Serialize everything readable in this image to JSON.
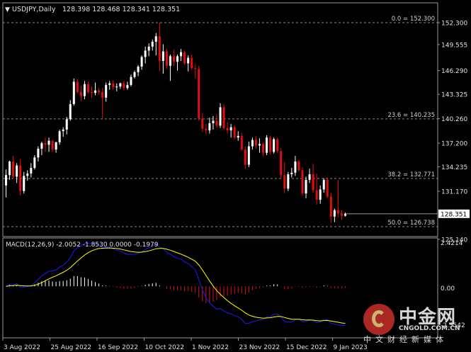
{
  "header": {
    "symbol_label": "USDJPY,Daily",
    "ohlc": "128.398 128.468 128.341 128.351",
    "marker": "▼"
  },
  "macd": {
    "label": "MACD(12,26,9) -2.0052 -1.8530 0.0000 -0.1979",
    "axis_top": "2.4214",
    "axis_zero": "0.00",
    "axis_bottom": "-2.5542"
  },
  "current_price_label": "128.351",
  "colors": {
    "bg": "#000000",
    "up": "#ffffff",
    "down": "#e01010",
    "fib": "#8a8a8a",
    "signal": "#ffff00",
    "macd_main": "#1a1aff",
    "text": "#d0d0d0"
  },
  "fib_levels": [
    {
      "label": "0.0 = 152.300",
      "price": 152.3
    },
    {
      "label": "23.6 = 140.235",
      "price": 140.235
    },
    {
      "label": "38.2 = 132.771",
      "price": 132.771
    },
    {
      "label": "50.0 = 126.738",
      "price": 126.738
    }
  ],
  "y_ticks": [
    "152.300",
    "149.555",
    "146.290",
    "143.325",
    "140.260",
    "137.200",
    "134.235",
    "131.170",
    "128.351",
    "125.140"
  ],
  "y_tick_values": [
    152.3,
    149.555,
    146.29,
    143.325,
    140.26,
    137.2,
    134.235,
    131.17,
    128.351,
    125.14
  ],
  "x_ticks": [
    "3 Aug 2022",
    "25 Aug 2022",
    "16 Sep 2022",
    "10 Oct 2022",
    "1 Nov 2022",
    "23 Nov 2022",
    "15 Dec 2022",
    "9 Jan 2023"
  ],
  "watermark": {
    "title": "中金网",
    "url": "CNGOLD.COM.CN",
    "tagline": "中文财经新媒体"
  },
  "chart_data": {
    "type": "candlestick",
    "title": "USDJPY,Daily",
    "candles": [
      {
        "o": 131.9,
        "h": 133.9,
        "l": 130.4,
        "c": 133.2
      },
      {
        "o": 133.2,
        "h": 135.0,
        "l": 132.6,
        "c": 134.9
      },
      {
        "o": 134.9,
        "h": 135.6,
        "l": 132.7,
        "c": 133.0
      },
      {
        "o": 133.0,
        "h": 134.7,
        "l": 132.2,
        "c": 134.4
      },
      {
        "o": 134.4,
        "h": 135.2,
        "l": 130.6,
        "c": 131.2
      },
      {
        "o": 131.2,
        "h": 133.6,
        "l": 130.9,
        "c": 133.1
      },
      {
        "o": 133.1,
        "h": 133.8,
        "l": 132.5,
        "c": 133.4
      },
      {
        "o": 133.4,
        "h": 134.7,
        "l": 132.9,
        "c": 134.1
      },
      {
        "o": 134.1,
        "h": 135.7,
        "l": 133.9,
        "c": 135.4
      },
      {
        "o": 135.4,
        "h": 136.8,
        "l": 134.9,
        "c": 136.5
      },
      {
        "o": 136.5,
        "h": 137.4,
        "l": 135.7,
        "c": 137.2
      },
      {
        "o": 137.2,
        "h": 137.9,
        "l": 136.1,
        "c": 137.0
      },
      {
        "o": 137.0,
        "h": 137.9,
        "l": 136.1,
        "c": 137.5
      },
      {
        "o": 137.5,
        "h": 137.6,
        "l": 136.1,
        "c": 136.4
      },
      {
        "o": 136.4,
        "h": 137.4,
        "l": 136.0,
        "c": 137.3
      },
      {
        "o": 137.3,
        "h": 138.9,
        "l": 137.0,
        "c": 138.7
      },
      {
        "o": 138.7,
        "h": 139.2,
        "l": 138.0,
        "c": 138.9
      },
      {
        "o": 138.9,
        "h": 140.5,
        "l": 138.3,
        "c": 140.2
      },
      {
        "o": 140.2,
        "h": 142.6,
        "l": 140.0,
        "c": 142.1
      },
      {
        "o": 142.1,
        "h": 145.3,
        "l": 141.9,
        "c": 144.9
      },
      {
        "o": 144.9,
        "h": 145.2,
        "l": 143.4,
        "c": 143.6
      },
      {
        "o": 143.6,
        "h": 144.4,
        "l": 142.5,
        "c": 143.1
      },
      {
        "o": 143.1,
        "h": 145.0,
        "l": 142.7,
        "c": 144.6
      },
      {
        "o": 144.6,
        "h": 144.9,
        "l": 143.4,
        "c": 143.6
      },
      {
        "o": 143.6,
        "h": 144.3,
        "l": 142.9,
        "c": 143.5
      },
      {
        "o": 143.5,
        "h": 144.8,
        "l": 143.2,
        "c": 143.8
      },
      {
        "o": 143.8,
        "h": 144.1,
        "l": 143.3,
        "c": 143.6
      },
      {
        "o": 143.6,
        "h": 144.1,
        "l": 140.3,
        "c": 142.9
      },
      {
        "o": 142.9,
        "h": 144.8,
        "l": 142.4,
        "c": 144.5
      },
      {
        "o": 144.5,
        "h": 145.0,
        "l": 143.9,
        "c": 144.7
      },
      {
        "o": 144.7,
        "h": 145.1,
        "l": 143.9,
        "c": 144.2
      },
      {
        "o": 144.2,
        "h": 144.7,
        "l": 143.7,
        "c": 144.3
      },
      {
        "o": 144.3,
        "h": 144.8,
        "l": 144.0,
        "c": 144.7
      },
      {
        "o": 144.7,
        "h": 145.0,
        "l": 143.8,
        "c": 144.1
      },
      {
        "o": 144.1,
        "h": 144.9,
        "l": 143.9,
        "c": 144.5
      },
      {
        "o": 144.5,
        "h": 145.8,
        "l": 144.3,
        "c": 145.5
      },
      {
        "o": 145.5,
        "h": 146.3,
        "l": 145.3,
        "c": 146.1
      },
      {
        "o": 146.1,
        "h": 147.0,
        "l": 145.6,
        "c": 146.8
      },
      {
        "o": 146.8,
        "h": 148.2,
        "l": 146.4,
        "c": 148.0
      },
      {
        "o": 148.0,
        "h": 149.3,
        "l": 147.2,
        "c": 148.8
      },
      {
        "o": 148.8,
        "h": 149.7,
        "l": 148.1,
        "c": 149.3
      },
      {
        "o": 149.3,
        "h": 150.2,
        "l": 148.8,
        "c": 149.9
      },
      {
        "o": 149.9,
        "h": 151.0,
        "l": 148.2,
        "c": 150.6
      },
      {
        "o": 150.6,
        "h": 152.3,
        "l": 146.2,
        "c": 147.5
      },
      {
        "o": 147.5,
        "h": 149.6,
        "l": 145.9,
        "c": 148.7
      },
      {
        "o": 148.7,
        "h": 149.0,
        "l": 146.5,
        "c": 146.9
      },
      {
        "o": 146.9,
        "h": 148.3,
        "l": 145.0,
        "c": 148.1
      },
      {
        "o": 148.1,
        "h": 148.9,
        "l": 146.9,
        "c": 147.4
      },
      {
        "o": 147.4,
        "h": 148.3,
        "l": 146.3,
        "c": 148.1
      },
      {
        "o": 148.1,
        "h": 149.0,
        "l": 147.5,
        "c": 148.6
      },
      {
        "o": 148.6,
        "h": 148.8,
        "l": 147.0,
        "c": 147.2
      },
      {
        "o": 147.2,
        "h": 148.2,
        "l": 146.2,
        "c": 147.9
      },
      {
        "o": 147.9,
        "h": 148.3,
        "l": 146.4,
        "c": 146.6
      },
      {
        "o": 146.6,
        "h": 147.1,
        "l": 145.3,
        "c": 146.5
      },
      {
        "o": 146.5,
        "h": 146.9,
        "l": 140.0,
        "c": 140.3
      },
      {
        "o": 140.3,
        "h": 141.0,
        "l": 138.6,
        "c": 139.0
      },
      {
        "o": 139.0,
        "h": 139.6,
        "l": 138.3,
        "c": 138.8
      },
      {
        "o": 138.8,
        "h": 140.4,
        "l": 138.4,
        "c": 139.7
      },
      {
        "o": 139.7,
        "h": 140.6,
        "l": 138.9,
        "c": 140.0
      },
      {
        "o": 140.0,
        "h": 140.8,
        "l": 139.1,
        "c": 139.4
      },
      {
        "o": 139.4,
        "h": 142.2,
        "l": 139.1,
        "c": 141.7
      },
      {
        "o": 141.7,
        "h": 142.1,
        "l": 138.9,
        "c": 139.1
      },
      {
        "o": 139.1,
        "h": 139.8,
        "l": 138.4,
        "c": 138.8
      },
      {
        "o": 138.8,
        "h": 139.6,
        "l": 137.9,
        "c": 139.2
      },
      {
        "o": 139.2,
        "h": 139.4,
        "l": 137.7,
        "c": 137.9
      },
      {
        "o": 137.9,
        "h": 138.7,
        "l": 137.5,
        "c": 138.1
      },
      {
        "o": 138.1,
        "h": 138.5,
        "l": 136.2,
        "c": 136.4
      },
      {
        "o": 136.4,
        "h": 136.8,
        "l": 134.0,
        "c": 134.5
      },
      {
        "o": 134.5,
        "h": 137.4,
        "l": 134.2,
        "c": 136.8
      },
      {
        "o": 136.8,
        "h": 137.9,
        "l": 136.4,
        "c": 137.6
      },
      {
        "o": 137.6,
        "h": 138.1,
        "l": 136.5,
        "c": 136.9
      },
      {
        "o": 136.9,
        "h": 137.8,
        "l": 136.0,
        "c": 137.1
      },
      {
        "o": 137.1,
        "h": 137.3,
        "l": 135.5,
        "c": 136.0
      },
      {
        "o": 136.0,
        "h": 138.2,
        "l": 135.7,
        "c": 137.9
      },
      {
        "o": 137.9,
        "h": 138.1,
        "l": 135.8,
        "c": 136.1
      },
      {
        "o": 136.1,
        "h": 137.9,
        "l": 135.9,
        "c": 137.7
      },
      {
        "o": 137.7,
        "h": 137.9,
        "l": 136.0,
        "c": 136.2
      },
      {
        "o": 136.2,
        "h": 136.6,
        "l": 132.7,
        "c": 133.2
      },
      {
        "o": 133.2,
        "h": 134.8,
        "l": 130.9,
        "c": 131.5
      },
      {
        "o": 131.5,
        "h": 133.6,
        "l": 131.2,
        "c": 133.3
      },
      {
        "o": 133.3,
        "h": 134.1,
        "l": 132.9,
        "c": 133.5
      },
      {
        "o": 133.5,
        "h": 135.6,
        "l": 133.1,
        "c": 134.9
      },
      {
        "o": 134.9,
        "h": 135.1,
        "l": 133.6,
        "c": 133.8
      },
      {
        "o": 133.8,
        "h": 134.2,
        "l": 130.6,
        "c": 130.9
      },
      {
        "o": 130.9,
        "h": 133.0,
        "l": 130.3,
        "c": 132.6
      },
      {
        "o": 132.6,
        "h": 134.0,
        "l": 132.2,
        "c": 133.3
      },
      {
        "o": 133.3,
        "h": 134.6,
        "l": 131.0,
        "c": 131.3
      },
      {
        "o": 131.3,
        "h": 133.4,
        "l": 129.5,
        "c": 130.1
      },
      {
        "o": 130.1,
        "h": 131.9,
        "l": 129.6,
        "c": 131.4
      },
      {
        "o": 131.4,
        "h": 132.8,
        "l": 131.0,
        "c": 132.6
      },
      {
        "o": 132.6,
        "h": 132.9,
        "l": 130.3,
        "c": 130.5
      },
      {
        "o": 130.5,
        "h": 131.0,
        "l": 127.2,
        "c": 128.0
      },
      {
        "o": 128.0,
        "h": 129.0,
        "l": 127.3,
        "c": 128.8
      },
      {
        "o": 128.8,
        "h": 132.6,
        "l": 127.9,
        "c": 128.4
      },
      {
        "o": 128.4,
        "h": 128.8,
        "l": 127.6,
        "c": 128.1
      },
      {
        "o": 128.1,
        "h": 128.5,
        "l": 128.0,
        "c": 128.35
      }
    ],
    "macd_histogram_note": "derived from candles",
    "ylim": [
      125.14,
      152.3
    ]
  }
}
